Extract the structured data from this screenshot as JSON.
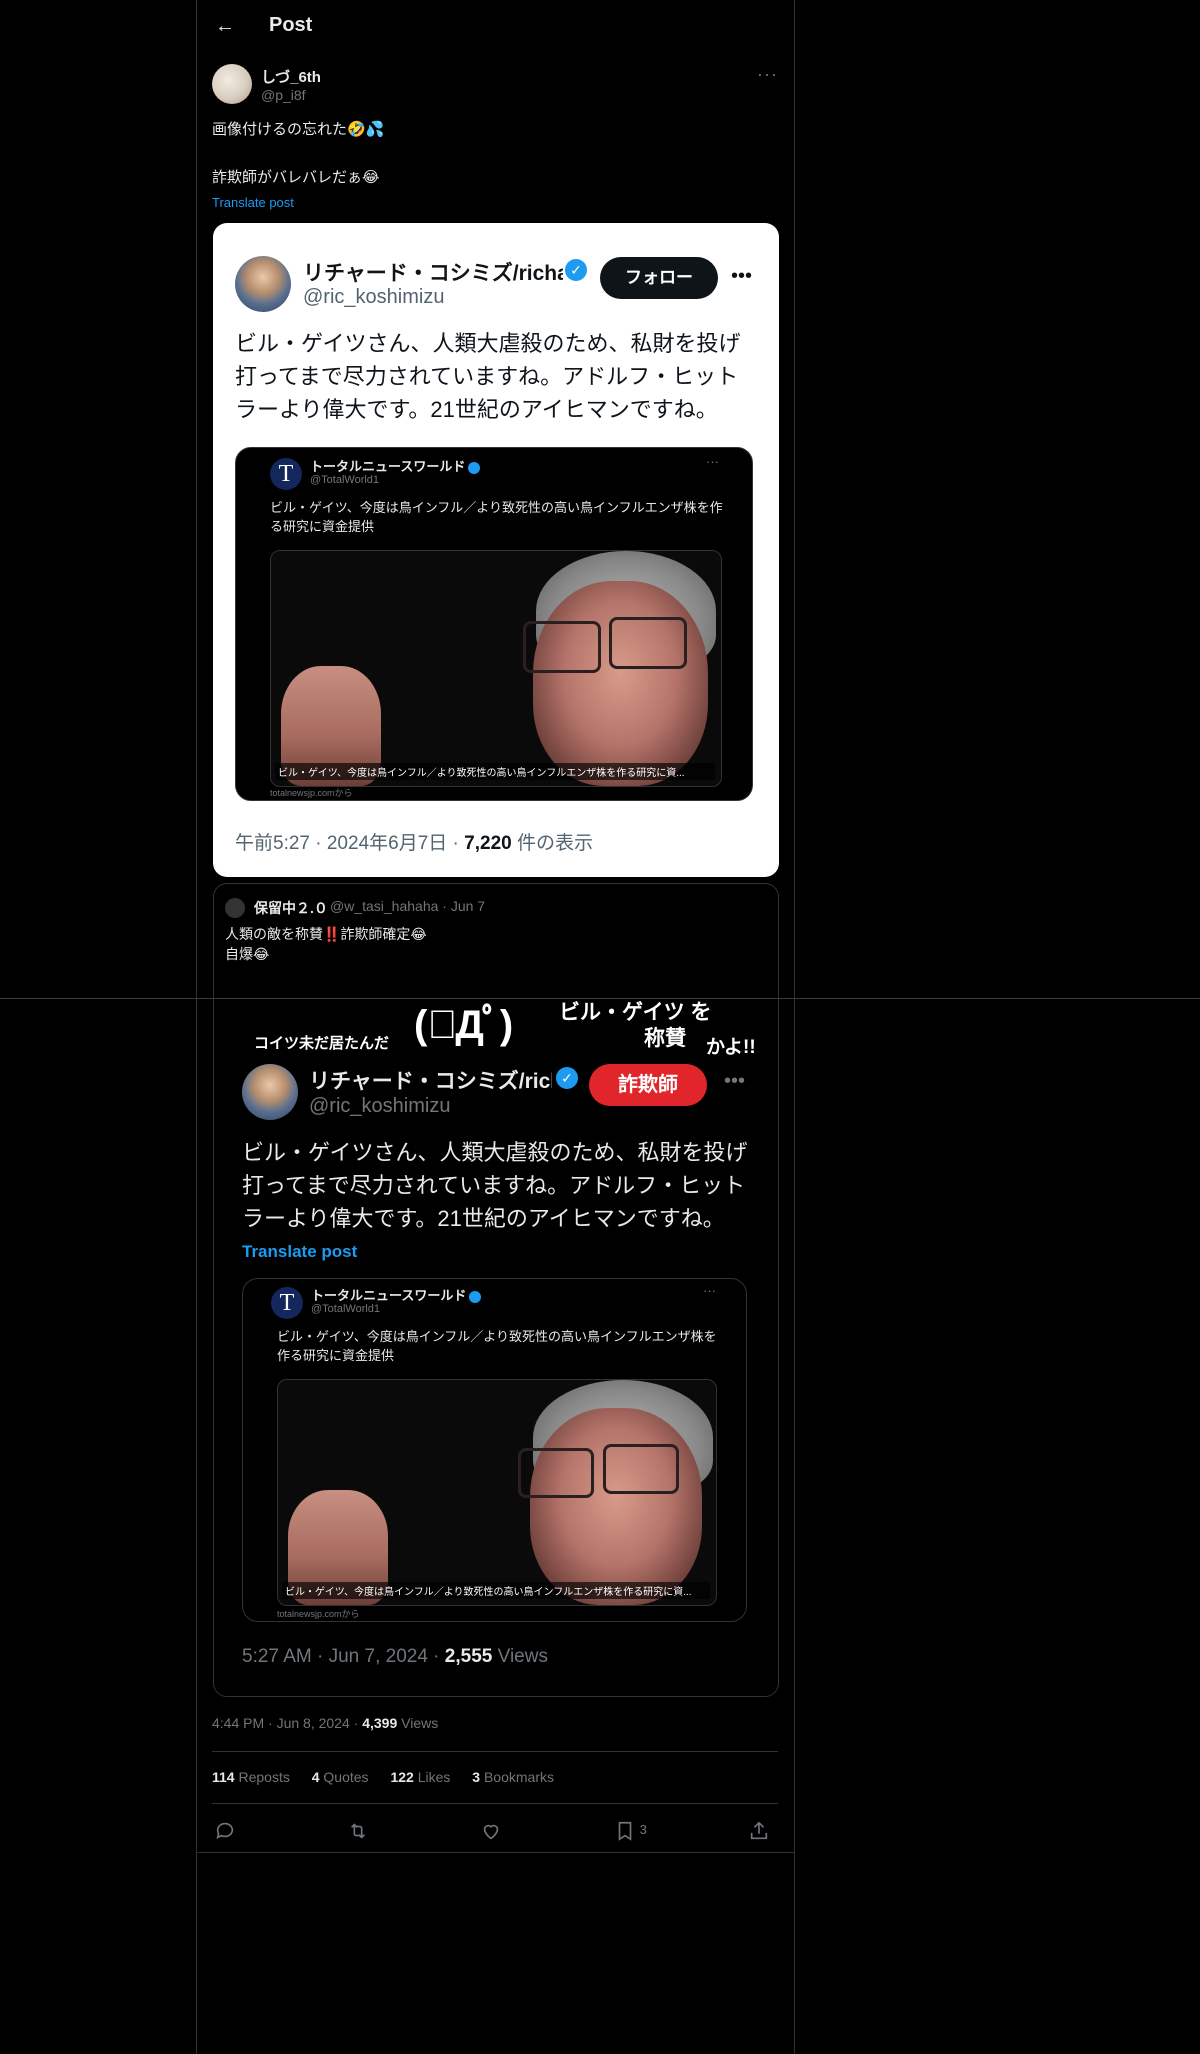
{
  "header": {
    "title": "Post"
  },
  "author": {
    "name": "しづ_6th",
    "handle": "@p_i8f"
  },
  "post": {
    "line1": "画像付けるの忘れた🤣💦",
    "line2": "詐欺師がバレバレだぁ😂",
    "translate": "Translate post"
  },
  "card1": {
    "name": "リチャード・コシミズ/richard",
    "handle": "@ric_koshimizu",
    "follow": "フォロー",
    "text": "ビル・ゲイツさん、人類大虐殺のため、私財を投げ打ってまで尽力されていますね。アドルフ・ヒットラーより偉大です。21世紀のアイヒマンですね。",
    "meta_time": "午前5:27 · 2024年6月7日 · ",
    "meta_views": "7,220",
    "meta_suffix": " 件の表示"
  },
  "quoted": {
    "avatar_letter": "T",
    "name": "トータルニュースワールド",
    "handle": "@TotalWorld1",
    "text": "ビル・ゲイツ、今度は鳥インフル／より致死性の高い鳥インフルエンザ株を作る研究に資金提供",
    "caption": "ビル・ゲイツ、今度は鳥インフル／より致死性の高い鳥インフルエンザ株を作る研究に資...",
    "source": "totalnewsjp.comから"
  },
  "reply": {
    "name": "保留中２.０",
    "handle": "@w_tasi_hahaha · Jun 7",
    "line1_a": "人類の敵を称賛",
    "line1_mark": "‼️",
    "line1_b": "詐欺師確定😂",
    "line2": "自爆😂"
  },
  "card2": {
    "top1": "コイツ未だ居たんだ",
    "kaomoji": "(ﾟДﾟ)",
    "top2": "ビル・ゲイツ を",
    "top3": "称賛",
    "top4": "かよ!!",
    "name": "リチャード・コシミズ/richard",
    "handle": "@ric_koshimizu",
    "label": "詐欺師",
    "text": "ビル・ゲイツさん、人類大虐殺のため、私財を投げ打ってまで尽力されていますね。アドルフ・ヒットラーより偉大です。21世紀のアイヒマンですね。",
    "translate": "Translate post",
    "meta_time": "5:27 AM · Jun 7, 2024 · ",
    "meta_views": "2,555",
    "meta_suffix": " Views"
  },
  "meta": {
    "time": "4:44 PM · Jun 8, 2024 · ",
    "views": "4,399",
    "views_label": " Views"
  },
  "stats": {
    "reposts": "114",
    "reposts_label": " Reposts",
    "quotes": "4",
    "quotes_label": " Quotes",
    "likes": "122",
    "likes_label": " Likes",
    "bookmarks": "3",
    "bookmarks_label": " Bookmarks"
  },
  "actions": {
    "bookmark_count": "3"
  },
  "colors": {
    "accent": "#1d9bf0",
    "background": "#000000",
    "danger": "#f4212e"
  }
}
